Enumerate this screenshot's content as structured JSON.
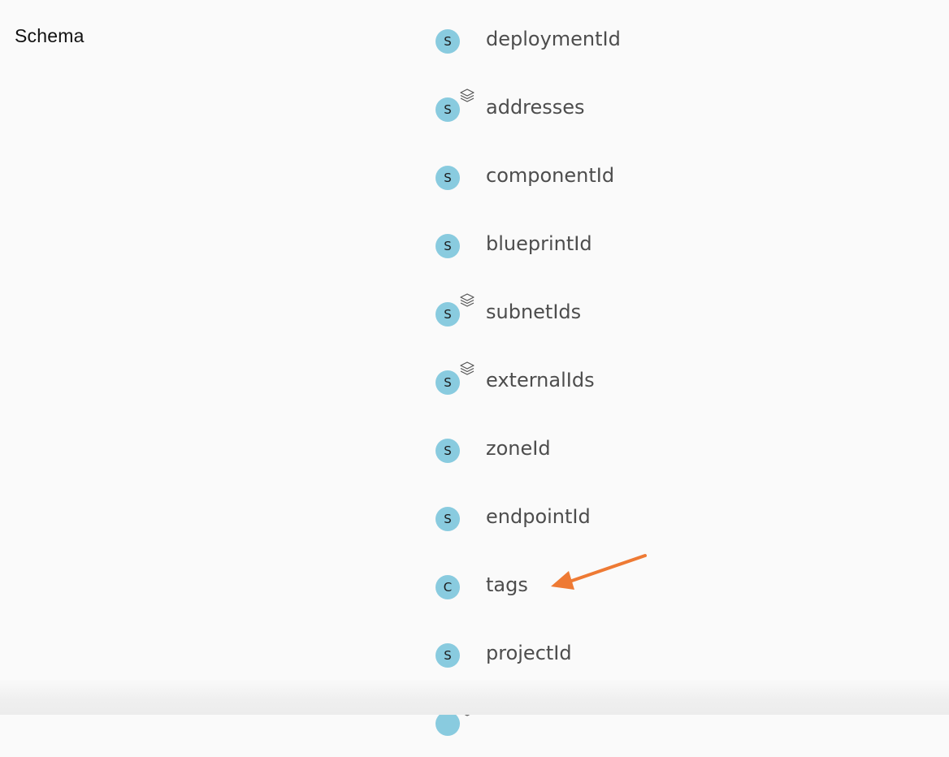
{
  "section": {
    "title": "Schema"
  },
  "theme": {
    "badge_color": "#89cbdf",
    "label_color": "#4d4d4d",
    "arrow_color": "#ee7a34",
    "layers_icon_name": "layers-icon"
  },
  "schema_items": [
    {
      "badge": "S",
      "label": "deploymentId",
      "has_layers_icon": false
    },
    {
      "badge": "S",
      "label": "addresses",
      "has_layers_icon": true
    },
    {
      "badge": "S",
      "label": "componentId",
      "has_layers_icon": false
    },
    {
      "badge": "S",
      "label": "blueprintId",
      "has_layers_icon": false
    },
    {
      "badge": "S",
      "label": "subnetIds",
      "has_layers_icon": true
    },
    {
      "badge": "S",
      "label": "externalIds",
      "has_layers_icon": true
    },
    {
      "badge": "S",
      "label": "zoneId",
      "has_layers_icon": false
    },
    {
      "badge": "S",
      "label": "endpointId",
      "has_layers_icon": false
    },
    {
      "badge": "C",
      "label": "tags",
      "has_layers_icon": false
    },
    {
      "badge": "S",
      "label": "projectId",
      "has_layers_icon": false
    },
    {
      "badge": "",
      "label": "",
      "has_layers_icon": true
    }
  ],
  "annotation": {
    "type": "arrow",
    "icon_name": "arrow-icon",
    "points_to": "tags"
  }
}
